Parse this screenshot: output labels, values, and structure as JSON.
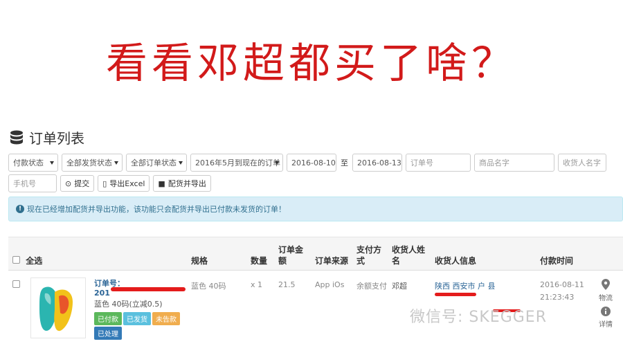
{
  "headline": "看看邓超都买了啥？",
  "page_title": "订单列表",
  "filters": {
    "payment_status": "付款状态",
    "ship_status": "全部发货状态",
    "order_status": "全部订单状态",
    "range": "2016年5月到现在的订单",
    "date_from": "2016-08-10",
    "date_sep": "至",
    "date_to": "2016-08-13",
    "order_no_placeholder": "订单号",
    "product_placeholder": "商品名字",
    "receiver_placeholder": "收货人名字",
    "phone_placeholder": "手机号",
    "submit_label": "提交",
    "export_label": "导出Excel",
    "ship_export_label": "配货并导出"
  },
  "notice": "现在已经增加配货并导出功能，该功能只会配货并导出已付款未发货的订单！",
  "table": {
    "select_all": "全选",
    "headers": {
      "spec": "规格",
      "qty": "数量",
      "amount_l1": "订单金",
      "amount_l2": "额",
      "source": "订单来源",
      "pay_l1": "支付方",
      "pay_l2": "式",
      "receiver_l1": "收货人姓",
      "receiver_l2": "名",
      "receiver_info": "收货人信息",
      "pay_time": "付款时间"
    },
    "row": {
      "order_no_label": "订单号：",
      "order_no_visible": "201",
      "variant": "蓝色 40码(立减0.5)",
      "spec": "蓝色 40码",
      "qty": "x 1",
      "amount": "21.5",
      "source": "App iOs",
      "pay_method": "余额支付",
      "receiver": "邓超",
      "address": "陕西 西安市 户   县",
      "pay_date": "2016-08-11",
      "pay_clock": "21:23:43",
      "tags": [
        "已付款",
        "已发货",
        "未告款",
        "已处理"
      ],
      "logistics": "物流",
      "details": "详情"
    }
  },
  "watermark": "微信号: SKEGGER",
  "colors": {
    "headline": "#d21a1a",
    "tag_paid": "#5cb85c",
    "tag_shipped": "#5bc0de",
    "tag_pending": "#f0ad4e",
    "tag_done": "#337ab7",
    "notice_bg": "#d9edf7"
  }
}
